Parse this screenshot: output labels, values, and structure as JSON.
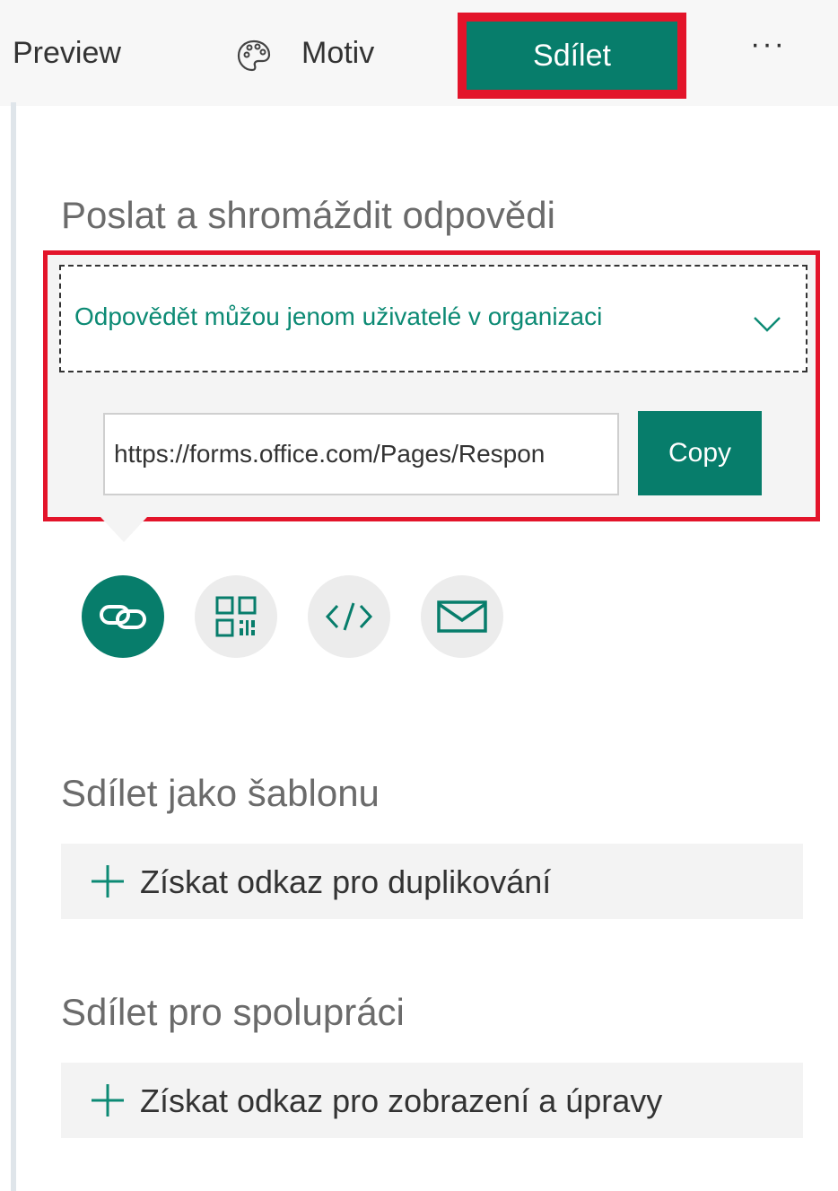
{
  "toolbar": {
    "preview_label": "Preview",
    "theme_label": "Motiv",
    "share_label": "Sdílet",
    "more_label": "···"
  },
  "send": {
    "title": "Poslat a shromáždit odpovědi",
    "audience_value": "Odpovědět můžou jenom uživatelé v organizaci",
    "link_value": "https://forms.office.com/Pages/Respon",
    "copy_label": "Copy",
    "share_methods": [
      "link-icon",
      "qr-code-icon",
      "embed-code-icon",
      "mail-icon"
    ]
  },
  "template": {
    "title": "Sdílet jako šablonu",
    "action_label": "Získat odkaz pro duplikování"
  },
  "collaborate": {
    "title": "Sdílet pro spolupráci",
    "action_label": "Získat odkaz pro zobrazení a úpravy"
  },
  "colors": {
    "accent": "#077d6b",
    "highlight": "#e3142a"
  }
}
